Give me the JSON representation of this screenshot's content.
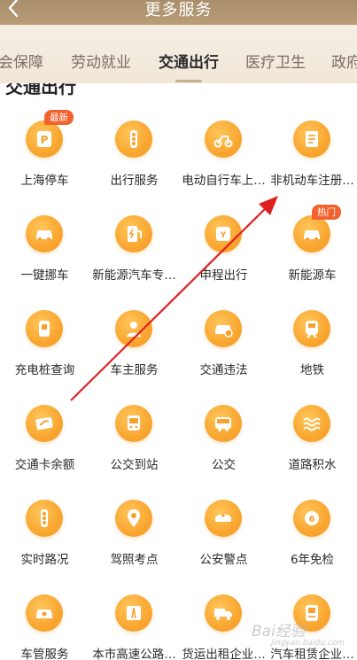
{
  "header": {
    "title": "更多服务"
  },
  "tabs": [
    {
      "label": "会保障",
      "active": false
    },
    {
      "label": "劳动就业",
      "active": false
    },
    {
      "label": "交通出行",
      "active": true
    },
    {
      "label": "医疗卫生",
      "active": false
    },
    {
      "label": "政府",
      "active": false
    }
  ],
  "section": {
    "title": "交通出行"
  },
  "services": [
    {
      "label": "上海停车",
      "icon": "parking-icon",
      "badge": "最新"
    },
    {
      "label": "出行服务",
      "icon": "traffic-light-icon"
    },
    {
      "label": "电动自行车上…",
      "icon": "e-bike-icon"
    },
    {
      "label": "非机动车注册…",
      "icon": "document-icon"
    },
    {
      "label": "一键挪车",
      "icon": "car-move-icon"
    },
    {
      "label": "新能源汽车专…",
      "icon": "charging-station-icon"
    },
    {
      "label": "申程出行",
      "icon": "ride-icon"
    },
    {
      "label": "新能源车",
      "icon": "car-icon",
      "badge": "热门"
    },
    {
      "label": "充电桩查询",
      "icon": "charger-icon"
    },
    {
      "label": "车主服务",
      "icon": "car-owner-icon"
    },
    {
      "label": "交通违法",
      "icon": "violation-icon"
    },
    {
      "label": "地铁",
      "icon": "metro-icon"
    },
    {
      "label": "交通卡余额",
      "icon": "card-icon"
    },
    {
      "label": "公交到站",
      "icon": "bus-arrival-icon"
    },
    {
      "label": "公交",
      "icon": "bus-icon"
    },
    {
      "label": "道路积水",
      "icon": "flood-icon"
    },
    {
      "label": "实时路况",
      "icon": "traffic-light-icon"
    },
    {
      "label": "驾照考点",
      "icon": "location-icon"
    },
    {
      "label": "公安警点",
      "icon": "police-cap-icon"
    },
    {
      "label": "6年免检",
      "icon": "inspection-icon"
    },
    {
      "label": "车管服务",
      "icon": "car-service-icon"
    },
    {
      "label": "本市高速公路…",
      "icon": "highway-icon"
    },
    {
      "label": "货运出租企业…",
      "icon": "truck-icon"
    },
    {
      "label": "汽车租赁企业…",
      "icon": "rental-icon"
    }
  ],
  "watermark": {
    "text": "Bai经验",
    "sub": "jingyan.baidu.com"
  },
  "colors": {
    "accent": "#f9a630",
    "header": "#b29773",
    "arrow": "#e02020",
    "badge": "#f2622e"
  }
}
